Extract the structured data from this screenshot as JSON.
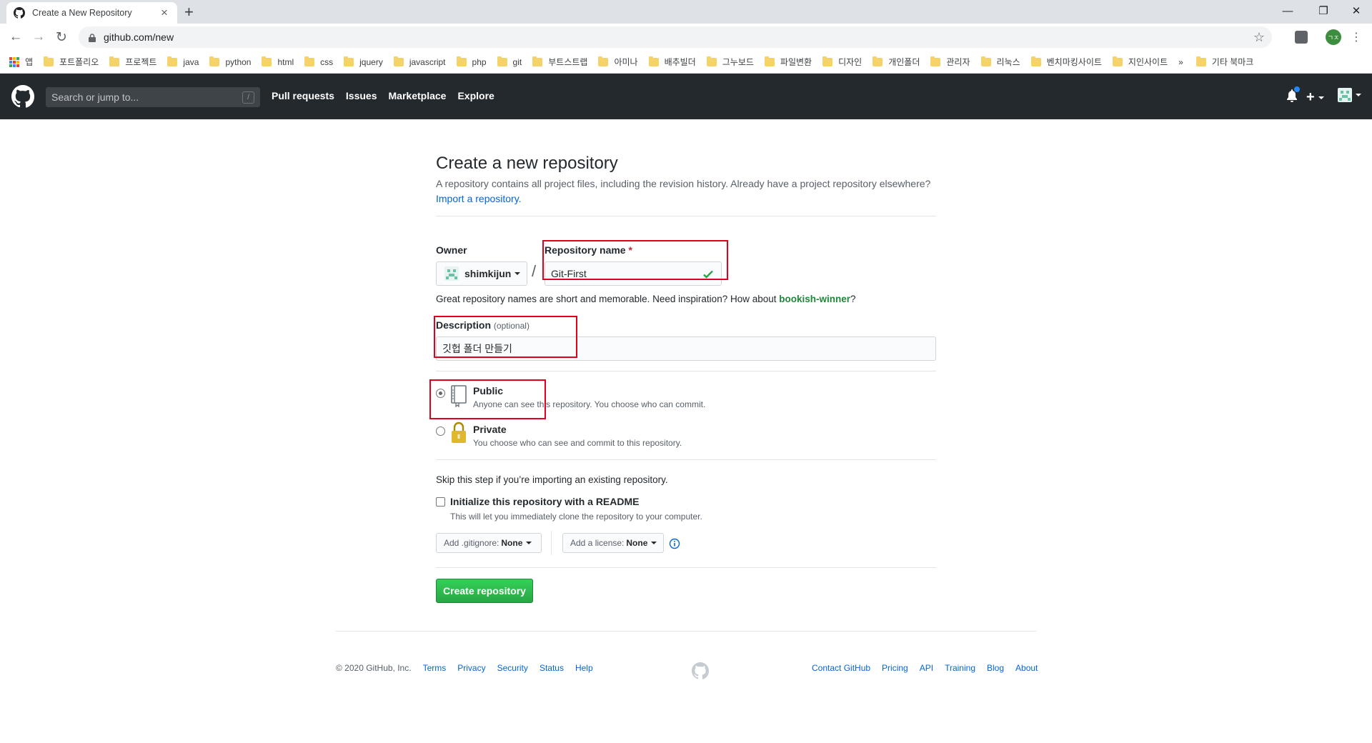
{
  "browser": {
    "tab_title": "Create a New Repository",
    "url": "github.com/new",
    "profile_initials": "ㄱㅈ",
    "bookmarks": [
      "앱",
      "포트폴리오",
      "프로젝트",
      "java",
      "python",
      "html",
      "css",
      "jquery",
      "javascript",
      "php",
      "git",
      "부트스트랩",
      "아미나",
      "배추빌더",
      "그누보드",
      "파일변환",
      "디자인",
      "개인폴더",
      "관리자",
      "리눅스",
      "벤치마킹사이트",
      "지인사이트"
    ],
    "more_bookmarks": "»",
    "other_bookmarks": "기타 북마크"
  },
  "github": {
    "search_placeholder": "Search or jump to...",
    "search_shortcut": "/",
    "nav": [
      "Pull requests",
      "Issues",
      "Marketplace",
      "Explore"
    ]
  },
  "form": {
    "title": "Create a new repository",
    "subhead": "A repository contains all project files, including the revision history. Already have a project repository elsewhere?",
    "import_link": "Import a repository.",
    "owner_label": "Owner",
    "owner_value": "shimkijun",
    "name_separator": "/",
    "repo_name_label": "Repository name",
    "required_mark": "*",
    "repo_name_value": "Git-First",
    "name_hint": "Great repository names are short and memorable. Need inspiration? How about",
    "name_suggestion": "bookish-winner",
    "name_hint_end": "?",
    "description_label": "Description",
    "description_optional": "(optional)",
    "description_value": "깃헙 폴더 만들기",
    "public_title": "Public",
    "public_desc": "Anyone can see this repository. You choose who can commit.",
    "private_title": "Private",
    "private_desc": "You choose who can see and commit to this repository.",
    "skip_note": "Skip this step if you’re importing an existing repository.",
    "readme_label": "Initialize this repository with a README",
    "readme_desc": "This will let you immediately clone the repository to your computer.",
    "gitignore_label": "Add .gitignore:",
    "gitignore_value": "None",
    "license_label": "Add a license:",
    "license_value": "None",
    "submit_label": "Create repository"
  },
  "footer": {
    "copyright": "© 2020 GitHub, Inc.",
    "left_links": [
      "Terms",
      "Privacy",
      "Security",
      "Status",
      "Help"
    ],
    "right_links": [
      "Contact GitHub",
      "Pricing",
      "API",
      "Training",
      "Blog",
      "About"
    ]
  },
  "colors": {
    "accent_link": "#0366d6",
    "header_bg": "#24292e",
    "create_button": "#28a745",
    "highlight_box": "#e0001b"
  }
}
